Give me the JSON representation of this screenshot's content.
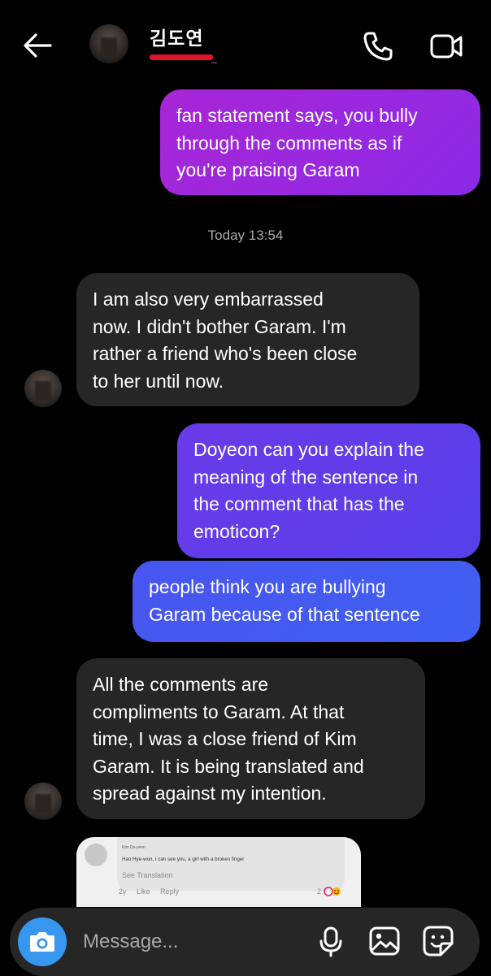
{
  "header": {
    "title": "김도연",
    "subtitle_tail": "_",
    "icons": [
      "back-arrow-icon",
      "phone-icon",
      "video-camera-icon"
    ]
  },
  "messages": [
    {
      "id": "b1",
      "direction": "sent",
      "lines": [
        "fan statement says, you bully",
        "through the comments as if",
        "you're praising Garam"
      ]
    },
    {
      "id": "b2",
      "direction": "received",
      "lines": [
        "I am also very embarrassed",
        "now. I didn't bother Garam. I'm",
        "rather a friend who's been close",
        "to her until now."
      ]
    },
    {
      "id": "b3",
      "direction": "sent",
      "lines": [
        "Doyeon can you explain the",
        "meaning of the sentence in",
        "the comment that has the",
        "emoticon?"
      ]
    },
    {
      "id": "b4",
      "direction": "sent",
      "lines": [
        "people think you are bullying",
        "Garam because of that sentence"
      ]
    },
    {
      "id": "b5",
      "direction": "received",
      "lines": [
        "All the comments are",
        "compliments to Garam. At that",
        "time, I was a close friend of Kim",
        "Garam. It is being translated and",
        "spread against my intention."
      ]
    }
  ],
  "timestamp": "Today 13:54",
  "attachment": {
    "commenter_name": "Kim Do-yeon",
    "comment_text": "Hao Hye-won, I can see you, a girl with a broken finger",
    "see_translation": "See Translation",
    "age": "2y",
    "like_label": "Like",
    "reply_label": "Reply",
    "reaction_count": "2"
  },
  "composer": {
    "placeholder": "Message...",
    "icons": [
      "camera-icon",
      "microphone-icon",
      "gallery-icon",
      "sticker-icon"
    ]
  },
  "colors": {
    "background": "#000000",
    "received_bubble": "#262626",
    "sent_purple": "#a826d6",
    "sent_violet": "#5c3ce8",
    "sent_blue": "#3f5ff2",
    "camera_button": "#3797f0",
    "redaction": "#e01428"
  }
}
